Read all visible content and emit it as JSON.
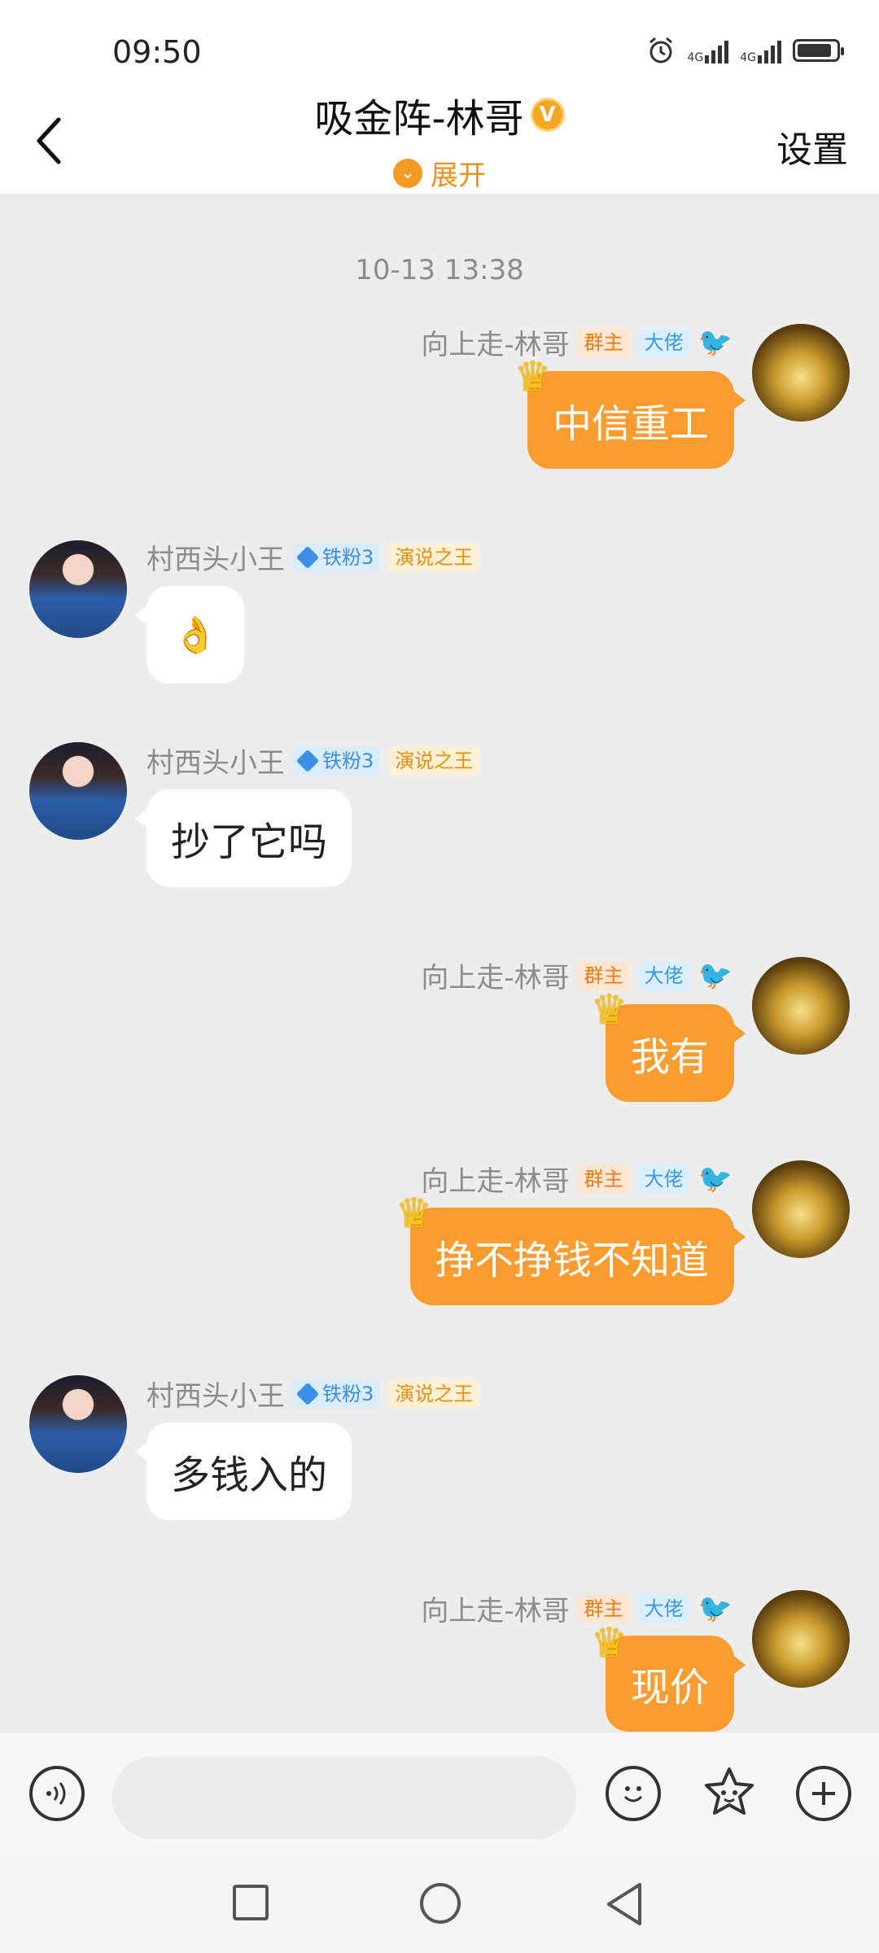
{
  "status": {
    "time": "09:50",
    "network": "4G"
  },
  "header": {
    "title": "吸金阵-林哥",
    "title_badge": "V",
    "expand_label": "展开",
    "settings_label": "设置"
  },
  "chat": {
    "timestamp": "10-13 13:38",
    "tags": {
      "owner": "群主",
      "boss": "大佬",
      "fan": "铁粉3",
      "king": "演说之王"
    },
    "senders": {
      "me": "向上走-林哥",
      "other": "村西头小王"
    },
    "messages": [
      {
        "from": "me",
        "text": "中信重工"
      },
      {
        "from": "other",
        "text": "👌"
      },
      {
        "from": "other",
        "text": "抄了它吗"
      },
      {
        "from": "me",
        "text": "我有"
      },
      {
        "from": "me",
        "text": "挣不挣钱不知道"
      },
      {
        "from": "other",
        "text": "多钱入的"
      },
      {
        "from": "me",
        "text": "现价"
      }
    ]
  },
  "input": {
    "placeholder": ""
  },
  "colors": {
    "accent": "#fa9c30",
    "background": "#ededed"
  }
}
